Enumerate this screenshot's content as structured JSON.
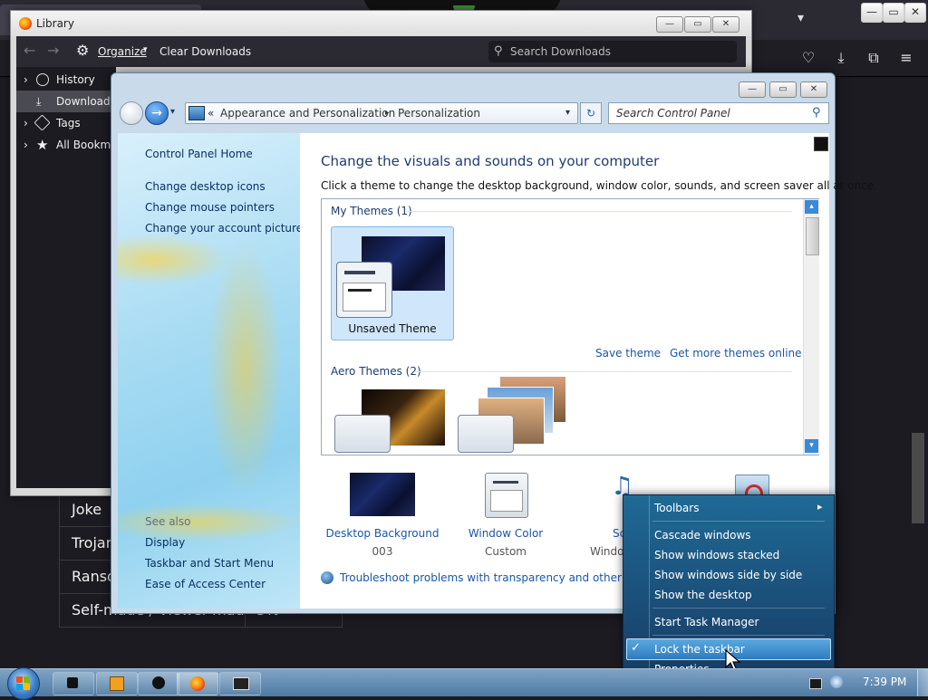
{
  "browser": {
    "table_rows": [
      {
        "label": "Joke",
        "value": ""
      },
      {
        "label": "Trojan",
        "value": ""
      },
      {
        "label": "Ransomware",
        "value": ""
      },
      {
        "label": "Self-made / Viewer-made",
        "value": "5%"
      }
    ]
  },
  "library": {
    "title": "Library",
    "toolbar": {
      "organize": "Organize",
      "clear_downloads": "Clear Downloads",
      "search_placeholder": "Search Downloads"
    },
    "sidebar": [
      "History",
      "Downloads",
      "Tags",
      "All Bookmarks"
    ]
  },
  "control_panel": {
    "address": {
      "prefix": "«",
      "crumb1": "Appearance and Personalization",
      "crumb2": "Personalization"
    },
    "search_placeholder": "Search Control Panel",
    "left_links": [
      "Control Panel Home",
      "Change desktop icons",
      "Change mouse pointers",
      "Change your account picture"
    ],
    "see_also_label": "See also",
    "see_also_links": [
      "Display",
      "Taskbar and Start Menu",
      "Ease of Access Center"
    ],
    "heading": "Change the visuals and sounds on your computer",
    "subheading": "Click a theme to change the desktop background, window color, sounds, and screen saver all at once.",
    "my_themes_label": "My Themes (1)",
    "unsaved_theme": "Unsaved Theme",
    "save_theme": "Save theme",
    "get_more_themes": "Get more themes online",
    "aero_themes_label": "Aero Themes (2)",
    "desktop_background": {
      "label": "Desktop Background",
      "value": "003"
    },
    "window_color": {
      "label": "Window Color",
      "value": "Custom"
    },
    "sounds": {
      "label": "Sc",
      "value": "Windo"
    },
    "troubleshoot": "Troubleshoot problems with transparency and other Aero e"
  },
  "context_menu": {
    "items": [
      "Toolbars",
      "Cascade windows",
      "Show windows stacked",
      "Show windows side by side",
      "Show the desktop",
      "Start Task Manager",
      "Lock the taskbar",
      "Properties"
    ],
    "checked": "✓",
    "submenu_arrow": "▸"
  },
  "taskbar": {
    "clock": "7:39 PM"
  },
  "icons": {
    "back": "←",
    "forward": "→",
    "gear": "⚙",
    "search": "⚲",
    "chevron_right": "›",
    "dropdown": "▾",
    "down": "▾",
    "up": "▴",
    "refresh": "↻",
    "minimize": "—",
    "maximize": "▭",
    "close": "✕",
    "menu": "≡",
    "download": "⤓",
    "extensions": "⧉",
    "pocket": "♡",
    "help": "?"
  }
}
